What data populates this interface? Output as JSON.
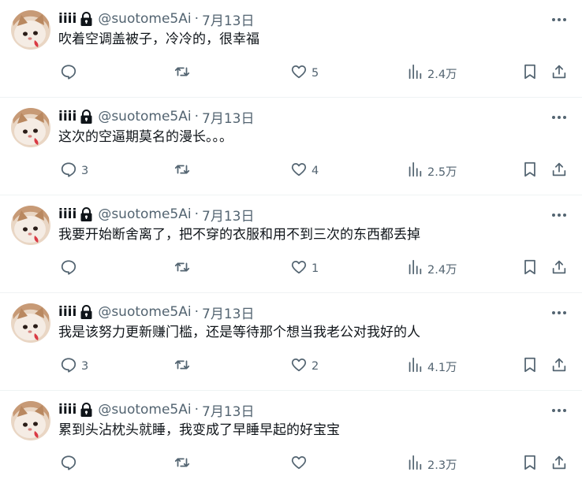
{
  "colors": {
    "text": "#0f1419",
    "secondary": "#536471",
    "divider": "#eff3f4"
  },
  "icons": {
    "more": "more-horizontal-icon",
    "lock": "lock-icon",
    "reply": "reply-icon",
    "retweet": "retweet-icon",
    "like": "heart-icon",
    "views": "views-chart-icon",
    "bookmark": "bookmark-icon",
    "share": "share-icon"
  },
  "tweets": [
    {
      "name": "iiii",
      "handle": "@suotome5Ai",
      "separator": "·",
      "date": "7月13日",
      "text": "吹着空调盖被子，冷冷的，很幸福",
      "replies": "",
      "retweets": "",
      "likes": "5",
      "views": "2.4万"
    },
    {
      "name": "iiii",
      "handle": "@suotome5Ai",
      "separator": "·",
      "date": "7月13日",
      "text": "这次的空逼期莫名的漫长。。。",
      "replies": "3",
      "retweets": "",
      "likes": "4",
      "views": "2.5万"
    },
    {
      "name": "iiii",
      "handle": "@suotome5Ai",
      "separator": "·",
      "date": "7月13日",
      "text": "我要开始断舍离了，把不穿的衣服和用不到三次的东西都丢掉",
      "replies": "",
      "retweets": "",
      "likes": "1",
      "views": "2.4万"
    },
    {
      "name": "iiii",
      "handle": "@suotome5Ai",
      "separator": "·",
      "date": "7月13日",
      "text": "我是该努力更新赚门槛，还是等待那个想当我老公对我好的人",
      "replies": "3",
      "retweets": "",
      "likes": "2",
      "views": "4.1万"
    },
    {
      "name": "iiii",
      "handle": "@suotome5Ai",
      "separator": "·",
      "date": "7月13日",
      "text": "累到头沾枕头就睡，我变成了早睡早起的好宝宝",
      "replies": "",
      "retweets": "",
      "likes": "",
      "views": "2.3万"
    }
  ]
}
